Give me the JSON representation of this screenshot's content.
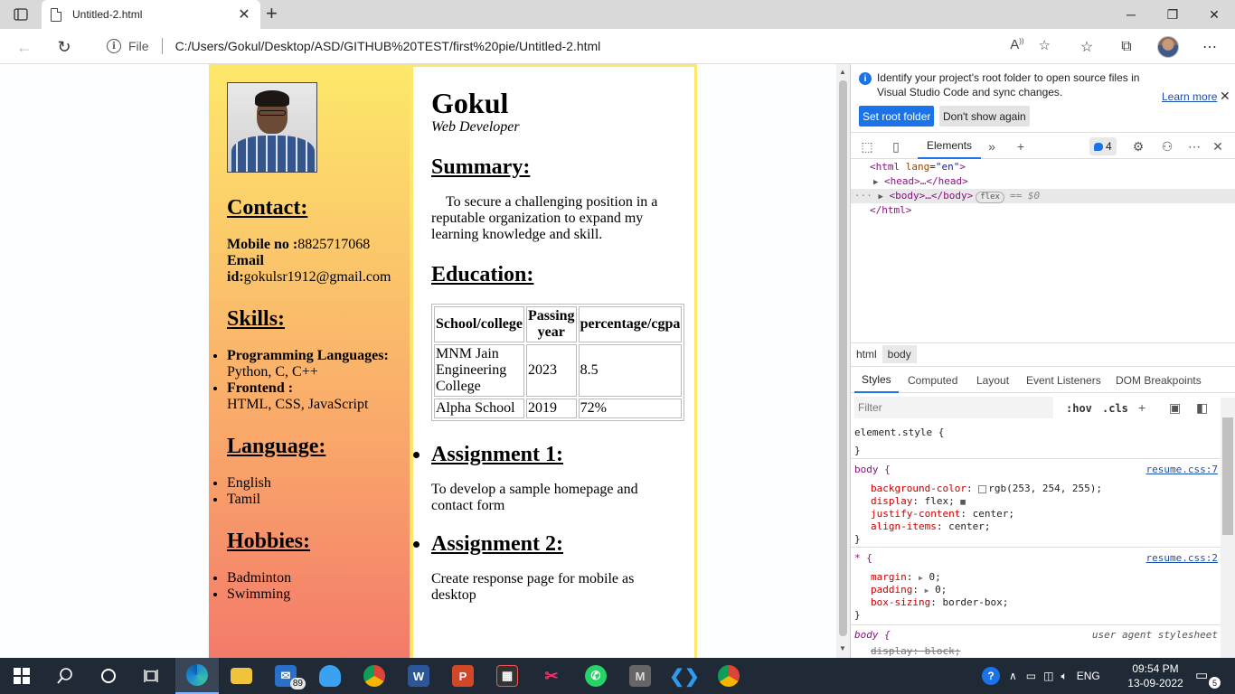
{
  "browser": {
    "tab_title": "Untitled-2.html",
    "file_label": "File",
    "url": "C:/Users/Gokul/Desktop/ASD/GITHUB%20TEST/first%20pie/Untitled-2.html"
  },
  "resume": {
    "name": "Gokul",
    "role": "Web Developer",
    "contact_heading": "Contact:",
    "mobile_label": "Mobile no :",
    "mobile_value": "8825717068",
    "email_label_1": "Email",
    "email_label_2": "id:",
    "email_value": "gokulsr1912@gmail.com",
    "skills_heading": "Skills:",
    "skills": [
      {
        "title": "Programming Languages:",
        "detail": "Python, C, C++"
      },
      {
        "title": "Frontend :",
        "detail": "HTML, CSS, JavaScript"
      }
    ],
    "language_heading": "Language:",
    "languages": [
      "English",
      "Tamil"
    ],
    "hobbies_heading": "Hobbies:",
    "hobbies": [
      "Badminton",
      "Swimming"
    ],
    "summary_heading": "Summary:",
    "summary_text": "To secure a challenging position in a reputable organization to expand my learning knowledge and skill.",
    "education_heading": "Education:",
    "education_table": {
      "headers": [
        "School/college",
        "Passing year",
        "percentage/cgpa"
      ],
      "rows": [
        [
          "MNM Jain Engineering College",
          "2023",
          "8.5"
        ],
        [
          "Alpha School",
          "2019",
          "72%"
        ]
      ]
    },
    "assignments": [
      {
        "title": "Assignment 1:",
        "text": "To develop a sample homepage and contact form"
      },
      {
        "title": "Assignment 2:",
        "text": "Create response page for mobile as desktop"
      }
    ]
  },
  "devtools": {
    "banner_text": "Identify your project's root folder to open source files in Visual Studio Code and sync changes.",
    "learn_more": "Learn more",
    "set_root_button": "Set root folder",
    "dont_show_button": "Don't show again",
    "elements_tab": "Elements",
    "issues_count": "4",
    "dom": {
      "html_open_tag": "html",
      "html_attr_name": "lang",
      "html_attr_value": "\"en\"",
      "head": "<head>…</head>",
      "body": "<body>…</body>",
      "flex_pill": "flex",
      "eq_sign": "== $0",
      "html_close": "</html>"
    },
    "breadcrumbs": [
      "html",
      "body"
    ],
    "style_tabs": [
      "Styles",
      "Computed",
      "Layout",
      "Event Listeners",
      "DOM Breakpoints"
    ],
    "filter_placeholder": "Filter",
    "hov": ":hov",
    "cls": ".cls",
    "rules": {
      "element_style": "element.style {",
      "close": "}",
      "body_selector": "body {",
      "body_source": "resume.css:7",
      "body_props": [
        [
          "background-color",
          "rgb(253, 254, 255);"
        ],
        [
          "display",
          "flex;"
        ],
        [
          "justify-content",
          "center;"
        ],
        [
          "align-items",
          "center;"
        ]
      ],
      "star_selector": "* {",
      "star_source": "resume.css:2",
      "star_props": [
        [
          "margin",
          "0;"
        ],
        [
          "padding",
          "0;"
        ],
        [
          "box-sizing",
          "border-box;"
        ]
      ],
      "ua_selector": "body {",
      "ua_source": "user agent stylesheet",
      "ua_prop": "display: block;"
    }
  },
  "taskbar": {
    "mail_badge": "89",
    "language": "ENG",
    "time": "09:54 PM",
    "date": "13-09-2022",
    "notification_count": "5"
  }
}
